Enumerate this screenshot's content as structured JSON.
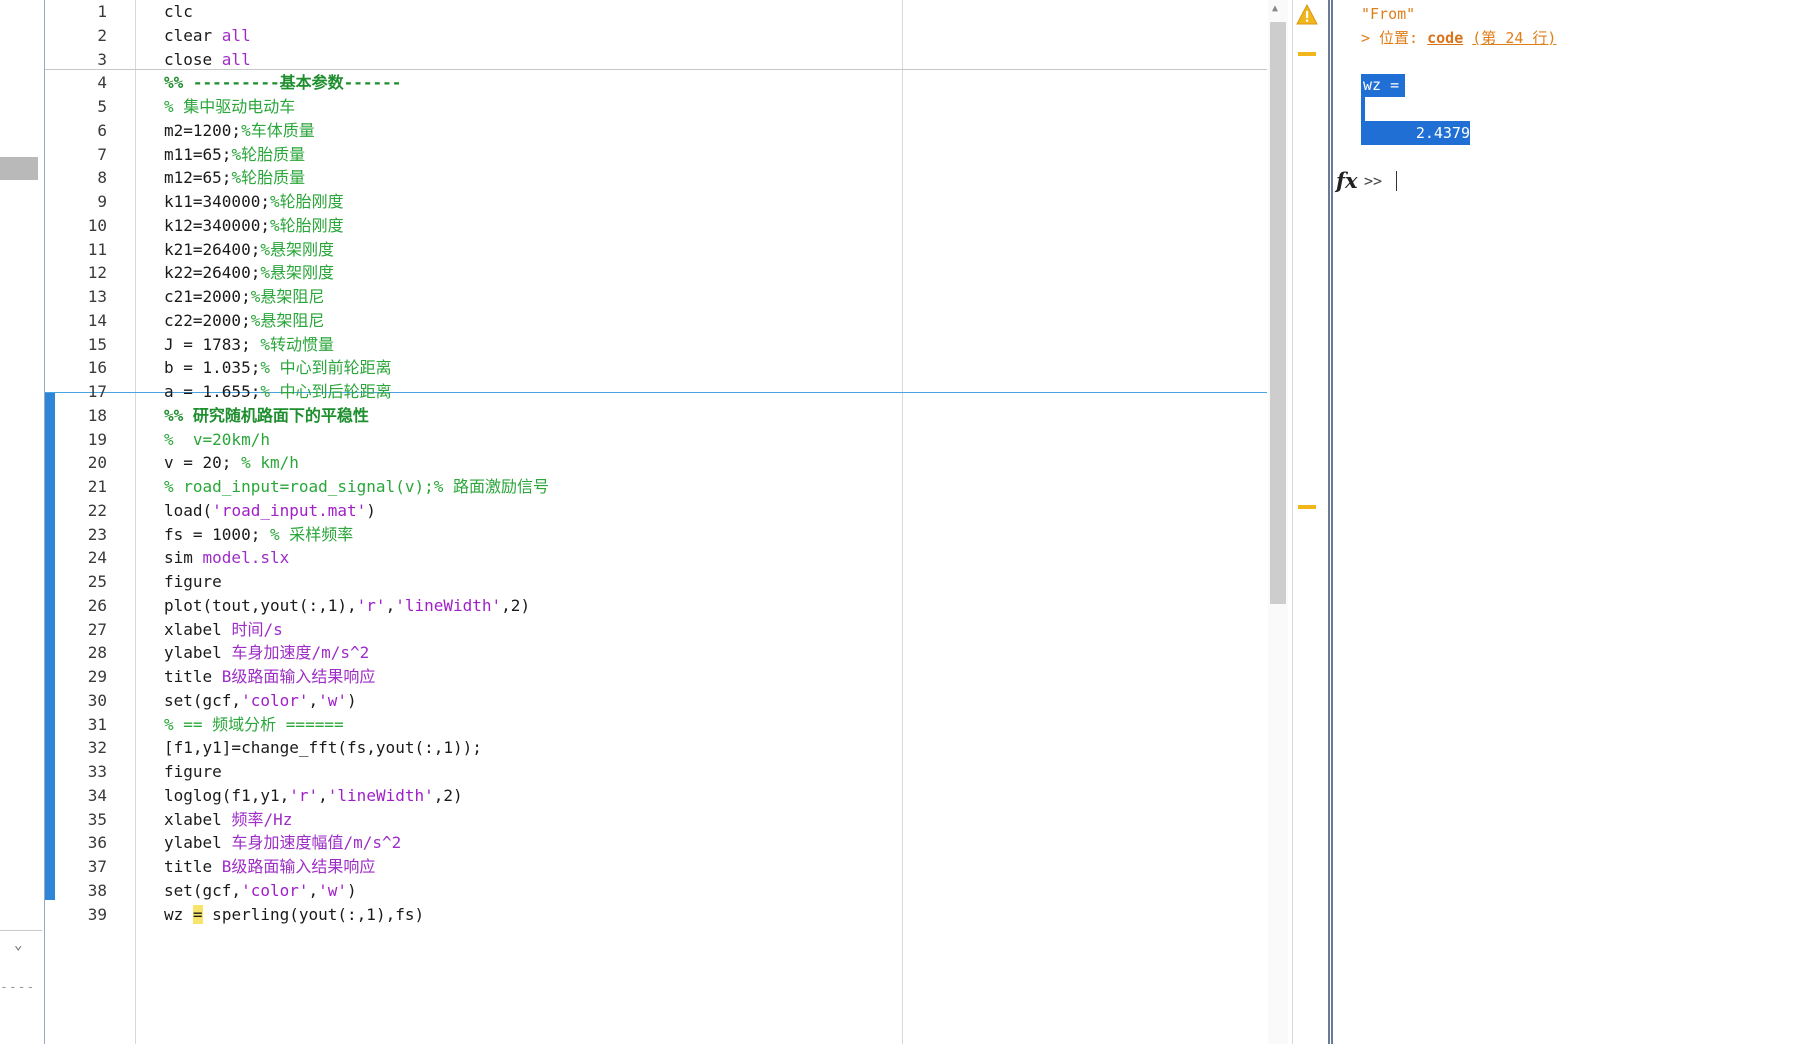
{
  "left_strip": {
    "collapse_glyph": "⌄",
    "dots": "----"
  },
  "editor": {
    "lines": [
      {
        "n": "1",
        "parts": [
          {
            "t": "clc",
            "c": ""
          }
        ]
      },
      {
        "n": "2",
        "parts": [
          {
            "t": "clear ",
            "c": ""
          },
          {
            "t": "all",
            "c": "k"
          }
        ]
      },
      {
        "n": "3",
        "parts": [
          {
            "t": "close ",
            "c": ""
          },
          {
            "t": "all",
            "c": "k"
          }
        ]
      },
      {
        "n": "4",
        "parts": [
          {
            "t": "%% ---------基本参数------",
            "c": "cs"
          }
        ]
      },
      {
        "n": "5",
        "parts": [
          {
            "t": "% 集中驱动电动车",
            "c": "c"
          }
        ]
      },
      {
        "n": "6",
        "parts": [
          {
            "t": "m2=1200;",
            "c": ""
          },
          {
            "t": "%车体质量",
            "c": "c"
          }
        ]
      },
      {
        "n": "7",
        "parts": [
          {
            "t": "m11=65;",
            "c": ""
          },
          {
            "t": "%轮胎质量",
            "c": "c"
          }
        ]
      },
      {
        "n": "8",
        "parts": [
          {
            "t": "m12=65;",
            "c": ""
          },
          {
            "t": "%轮胎质量",
            "c": "c"
          }
        ]
      },
      {
        "n": "9",
        "parts": [
          {
            "t": "k11=340000;",
            "c": ""
          },
          {
            "t": "%轮胎刚度",
            "c": "c"
          }
        ]
      },
      {
        "n": "10",
        "parts": [
          {
            "t": "k12=340000;",
            "c": ""
          },
          {
            "t": "%轮胎刚度",
            "c": "c"
          }
        ]
      },
      {
        "n": "11",
        "parts": [
          {
            "t": "k21=26400;",
            "c": ""
          },
          {
            "t": "%悬架刚度",
            "c": "c"
          }
        ]
      },
      {
        "n": "12",
        "parts": [
          {
            "t": "k22=26400;",
            "c": ""
          },
          {
            "t": "%悬架刚度",
            "c": "c"
          }
        ]
      },
      {
        "n": "13",
        "parts": [
          {
            "t": "c21=2000;",
            "c": ""
          },
          {
            "t": "%悬架阻尼",
            "c": "c"
          }
        ]
      },
      {
        "n": "14",
        "parts": [
          {
            "t": "c22=2000;",
            "c": ""
          },
          {
            "t": "%悬架阻尼",
            "c": "c"
          }
        ]
      },
      {
        "n": "15",
        "parts": [
          {
            "t": "J = 1783; ",
            "c": ""
          },
          {
            "t": "%转动惯量",
            "c": "c"
          }
        ]
      },
      {
        "n": "16",
        "parts": [
          {
            "t": "b = 1.035;",
            "c": ""
          },
          {
            "t": "% 中心到前轮距离",
            "c": "c"
          }
        ]
      },
      {
        "n": "17",
        "parts": [
          {
            "t": "a = 1.655;",
            "c": ""
          },
          {
            "t": "% 中心到后轮距离",
            "c": "c"
          }
        ]
      },
      {
        "n": "18",
        "parts": [
          {
            "t": "%% 研究随机路面下的平稳性",
            "c": "cs"
          }
        ]
      },
      {
        "n": "19",
        "parts": [
          {
            "t": "%  v=20km/h",
            "c": "c"
          }
        ]
      },
      {
        "n": "20",
        "parts": [
          {
            "t": "v = 20; ",
            "c": ""
          },
          {
            "t": "% km/h",
            "c": "c"
          }
        ]
      },
      {
        "n": "21",
        "parts": [
          {
            "t": "% road_input=road_signal(v);% 路面激励信号",
            "c": "c"
          }
        ]
      },
      {
        "n": "22",
        "parts": [
          {
            "t": "load(",
            "c": ""
          },
          {
            "t": "'road_input.mat'",
            "c": "s"
          },
          {
            "t": ")",
            "c": ""
          }
        ]
      },
      {
        "n": "23",
        "parts": [
          {
            "t": "fs = 1000; ",
            "c": ""
          },
          {
            "t": "% 采样频率",
            "c": "c"
          }
        ]
      },
      {
        "n": "24",
        "parts": [
          {
            "t": "sim ",
            "c": ""
          },
          {
            "t": "model.slx",
            "c": "k"
          }
        ]
      },
      {
        "n": "25",
        "parts": [
          {
            "t": "figure",
            "c": ""
          }
        ]
      },
      {
        "n": "26",
        "parts": [
          {
            "t": "plot(tout,yout(:,1),",
            "c": ""
          },
          {
            "t": "'r'",
            "c": "s"
          },
          {
            "t": ",",
            "c": ""
          },
          {
            "t": "'lineWidth'",
            "c": "s"
          },
          {
            "t": ",2)",
            "c": ""
          }
        ]
      },
      {
        "n": "27",
        "parts": [
          {
            "t": "xlabel ",
            "c": ""
          },
          {
            "t": "时间/s",
            "c": "k"
          }
        ]
      },
      {
        "n": "28",
        "parts": [
          {
            "t": "ylabel ",
            "c": ""
          },
          {
            "t": "车身加速度/m/s^2",
            "c": "k"
          }
        ]
      },
      {
        "n": "29",
        "parts": [
          {
            "t": "title ",
            "c": ""
          },
          {
            "t": "B级路面输入结果响应",
            "c": "k"
          }
        ]
      },
      {
        "n": "30",
        "parts": [
          {
            "t": "set(gcf,",
            "c": ""
          },
          {
            "t": "'color'",
            "c": "s"
          },
          {
            "t": ",",
            "c": ""
          },
          {
            "t": "'w'",
            "c": "s"
          },
          {
            "t": ")",
            "c": ""
          }
        ]
      },
      {
        "n": "31",
        "parts": [
          {
            "t": "% == 频域分析 ======",
            "c": "c"
          }
        ]
      },
      {
        "n": "32",
        "parts": [
          {
            "t": "[f1,y1]=change_fft(fs,yout(:,1));",
            "c": ""
          }
        ]
      },
      {
        "n": "33",
        "parts": [
          {
            "t": "figure",
            "c": ""
          }
        ]
      },
      {
        "n": "34",
        "parts": [
          {
            "t": "loglog(f1,y1,",
            "c": ""
          },
          {
            "t": "'r'",
            "c": "s"
          },
          {
            "t": ",",
            "c": ""
          },
          {
            "t": "'lineWidth'",
            "c": "s"
          },
          {
            "t": ",2)",
            "c": ""
          }
        ]
      },
      {
        "n": "35",
        "parts": [
          {
            "t": "xlabel ",
            "c": ""
          },
          {
            "t": "频率/Hz",
            "c": "k"
          }
        ]
      },
      {
        "n": "36",
        "parts": [
          {
            "t": "ylabel ",
            "c": ""
          },
          {
            "t": "车身加速度幅值/m/s^2",
            "c": "k"
          }
        ]
      },
      {
        "n": "37",
        "parts": [
          {
            "t": "title ",
            "c": ""
          },
          {
            "t": "B级路面输入结果响应",
            "c": "k"
          }
        ]
      },
      {
        "n": "38",
        "parts": [
          {
            "t": "set(gcf,",
            "c": ""
          },
          {
            "t": "'color'",
            "c": "s"
          },
          {
            "t": ",",
            "c": ""
          },
          {
            "t": "'w'",
            "c": "s"
          },
          {
            "t": ")",
            "c": ""
          }
        ]
      },
      {
        "n": "39",
        "parts": [
          {
            "t": "wz ",
            "c": ""
          },
          {
            "t": "=",
            "c": "hl"
          },
          {
            "t": " sperling(yout(:,1),fs)",
            "c": ""
          }
        ]
      }
    ]
  },
  "analyzer": {
    "icon": "warning-triangle-icon",
    "color": "#f2b61d"
  },
  "command_window": {
    "error_from": "\"From\"",
    "location_prefix": "> 位置: ",
    "location_link": "code",
    "location_line": "(第 24 行)",
    "var_name": "wz =",
    "var_value": "2.4379",
    "prompt": ">>",
    "selection_color": "#1f6fd4"
  }
}
